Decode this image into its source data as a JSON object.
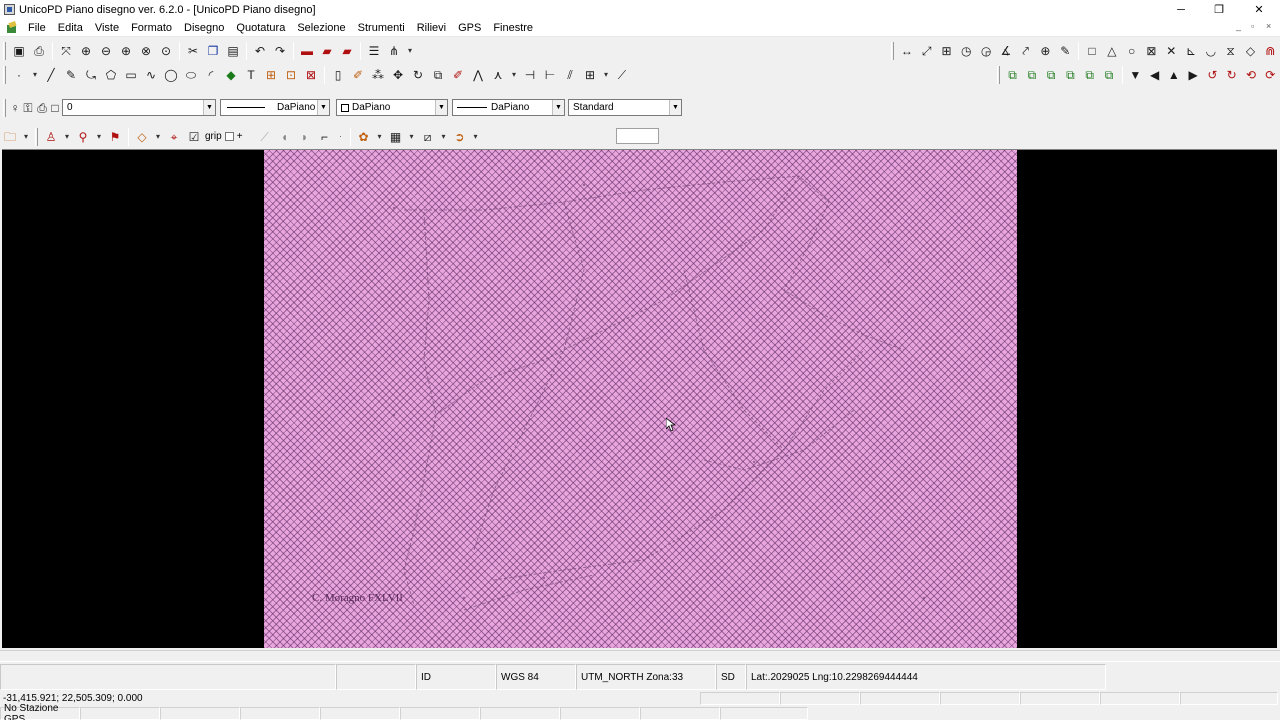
{
  "window": {
    "title": "UnicoPD Piano disegno ver. 6.2.0 - [UnicoPD Piano disegno]",
    "controls": {
      "minimize": "─",
      "restore": "❐",
      "close": "✕"
    }
  },
  "menu": [
    "File",
    "Edita",
    "Viste",
    "Formato",
    "Disegno",
    "Quotatura",
    "Selezione",
    "Strumenti",
    "Rilievi",
    "GPS",
    "Finestre"
  ],
  "mdi_controls": {
    "minimize": "_",
    "restore": "▫",
    "close": "×"
  },
  "properties_bar": {
    "layer": "0",
    "linetype": "DaPiano",
    "color": "DaPiano",
    "lineweight": "DaPiano",
    "style": "Standard"
  },
  "snap_bar": {
    "grip_label": "grip",
    "grip_plus": "+"
  },
  "map": {
    "caption": "C. Moragno FXLVII"
  },
  "status": {
    "id": "ID",
    "datum": "WGS 84",
    "projection": "UTM_NORTH  Zona:33",
    "sd": "SD",
    "latlng": "Lat:.2029025  Lng:10.2298269444444"
  },
  "coords": "-31,415.921; 22,505.309; 0.000",
  "gps_status": "No Stazione GPS",
  "colors": {
    "map_fill": "#e9a6dc",
    "hatch": "#5c2864",
    "canvas_bg": "#000000"
  }
}
